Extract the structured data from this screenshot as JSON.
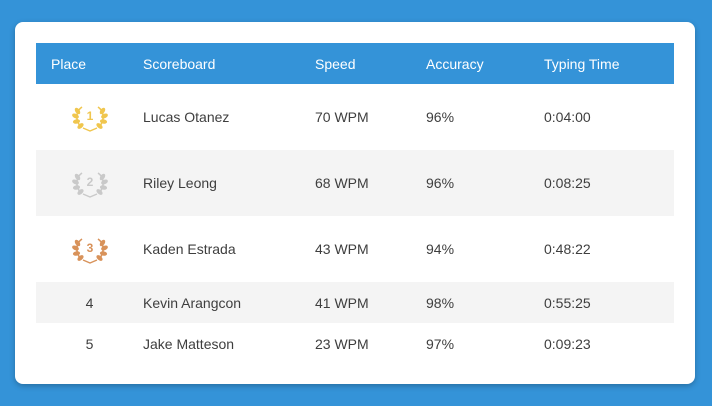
{
  "colors": {
    "background": "#3493d8",
    "header": "#3493d8",
    "gold": "#f0c64e",
    "silver": "#c9c9c9",
    "bronze": "#d8925a"
  },
  "headers": {
    "place": "Place",
    "scoreboard": "Scoreboard",
    "speed": "Speed",
    "accuracy": "Accuracy",
    "typing_time": "Typing Time"
  },
  "rows": [
    {
      "place": "1",
      "name": "Lucas Otanez",
      "speed": "70 WPM",
      "accuracy": "96%",
      "time": "0:04:00",
      "medal": "gold-laurel-icon"
    },
    {
      "place": "2",
      "name": "Riley Leong",
      "speed": "68 WPM",
      "accuracy": "96%",
      "time": "0:08:25",
      "medal": "silver-laurel-icon"
    },
    {
      "place": "3",
      "name": "Kaden Estrada",
      "speed": "43 WPM",
      "accuracy": "94%",
      "time": "0:48:22",
      "medal": "bronze-laurel-icon"
    },
    {
      "place": "4",
      "name": "Kevin Arangcon",
      "speed": "41 WPM",
      "accuracy": "98%",
      "time": "0:55:25"
    },
    {
      "place": "5",
      "name": "Jake Matteson",
      "speed": "23 WPM",
      "accuracy": "97%",
      "time": "0:09:23"
    }
  ]
}
